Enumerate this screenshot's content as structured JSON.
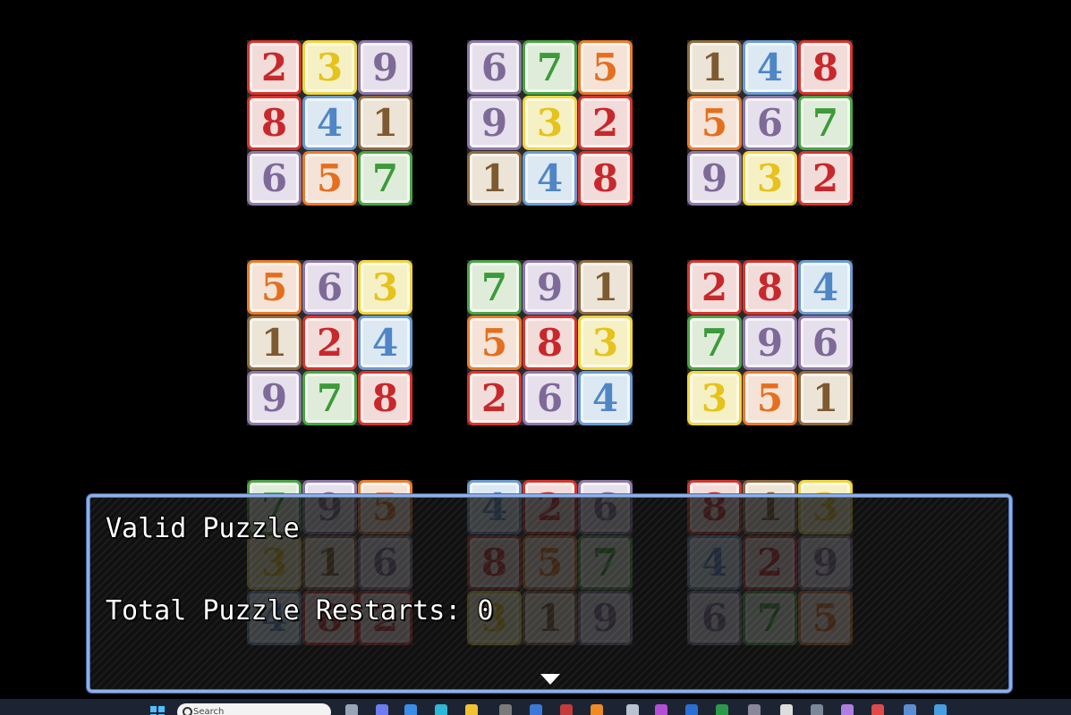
{
  "colors": {
    "red": {
      "fill": "#f2dcd9",
      "border": "#d8342c",
      "text": "#c8282c"
    },
    "yellow": {
      "fill": "#f6f1c4",
      "border": "#f0d540",
      "text": "#e6c21c"
    },
    "purple": {
      "fill": "#e6e0ec",
      "border": "#8d78a8",
      "text": "#7e6a98"
    },
    "blue": {
      "fill": "#dce8f2",
      "border": "#6b9bd2",
      "text": "#4f86c6"
    },
    "brown": {
      "fill": "#ece4d6",
      "border": "#8f6b3f",
      "text": "#7d5a30"
    },
    "orange": {
      "fill": "#f4e3d6",
      "border": "#ec7a2a",
      "text": "#e46f1e"
    },
    "green": {
      "fill": "#e0ecda",
      "border": "#4aa545",
      "text": "#3c9a3a"
    }
  },
  "digit_colors": {
    "1": "brown",
    "2": "red",
    "3": "yellow",
    "4": "blue",
    "5": "orange",
    "6": "purple",
    "7": "green",
    "8": "red",
    "9": "purple"
  },
  "puzzle": {
    "blocks": [
      [
        "2",
        "3",
        "9",
        "8",
        "4",
        "1",
        "6",
        "5",
        "7"
      ],
      [
        "6",
        "7",
        "5",
        "9",
        "3",
        "2",
        "1",
        "4",
        "8"
      ],
      [
        "1",
        "4",
        "8",
        "5",
        "6",
        "7",
        "9",
        "3",
        "2"
      ],
      [
        "5",
        "6",
        "3",
        "1",
        "2",
        "4",
        "9",
        "7",
        "8"
      ],
      [
        "7",
        "9",
        "1",
        "5",
        "8",
        "3",
        "2",
        "6",
        "4"
      ],
      [
        "2",
        "8",
        "4",
        "7",
        "9",
        "6",
        "3",
        "5",
        "1"
      ],
      [
        "7",
        "9",
        "5",
        "3",
        "1",
        "6",
        "4",
        "8",
        "2"
      ],
      [
        "4",
        "2",
        "6",
        "8",
        "5",
        "7",
        "3",
        "1",
        "9"
      ],
      [
        "8",
        "1",
        "3",
        "4",
        "2",
        "9",
        "6",
        "7",
        "5"
      ]
    ]
  },
  "message": {
    "line1": "Valid Puzzle",
    "line2": "Total Puzzle Restarts: 0"
  },
  "taskbar": {
    "search_placeholder": "Search"
  }
}
